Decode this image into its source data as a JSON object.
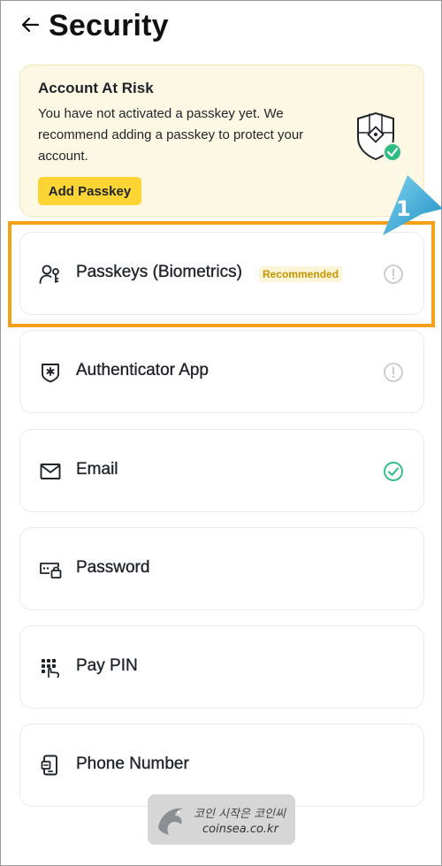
{
  "header": {
    "title": "Security"
  },
  "risk_banner": {
    "title": "Account At Risk",
    "message": "You have not activated a passkey yet. We recommend adding a passkey to protect your account.",
    "button_label": "Add Passkey"
  },
  "items": [
    {
      "label": "Passkeys (Biometrics)",
      "badge": "Recommended",
      "icon": "user-key-icon",
      "status": "warning"
    },
    {
      "label": "Authenticator App",
      "icon": "authenticator-shield-icon",
      "status": "warning"
    },
    {
      "label": "Email",
      "icon": "envelope-icon",
      "status": "verified"
    },
    {
      "label": "Password",
      "icon": "password-lock-icon",
      "status": "none"
    },
    {
      "label": "Pay PIN",
      "icon": "keypad-icon",
      "status": "none"
    },
    {
      "label": "Phone Number",
      "icon": "phone-icon",
      "status": "none"
    }
  ],
  "annotation": {
    "step_number": "1"
  },
  "watermark": {
    "line1": "코인 시작은 코인씨",
    "line2": "coinsea.co.kr"
  },
  "colors": {
    "accent_yellow": "#fcd535",
    "banner_bg": "#fdf8e4",
    "success_green": "#2ebd85",
    "badge_text": "#c99400",
    "highlight_orange": "#f6a01a",
    "pointer_blue": "#2fa8d8"
  }
}
